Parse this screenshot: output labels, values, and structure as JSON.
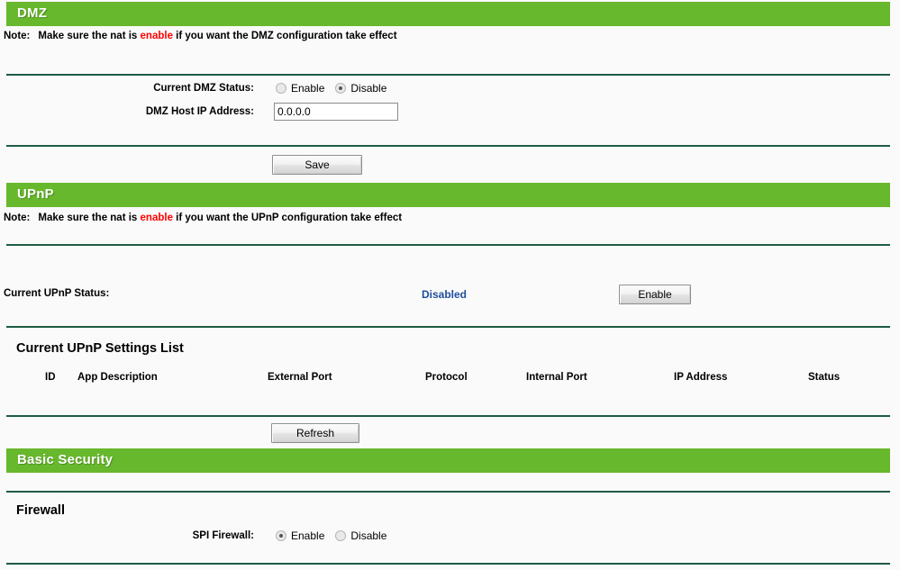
{
  "theme": {
    "bar_green": "#68b82d",
    "divider_green": "#1f5c43",
    "link_blue": "#1f4e9c",
    "note_highlight": "#ff0000",
    "page_bg": "#fafafa"
  },
  "sections": {
    "dmz": {
      "title": "DMZ",
      "note_prefix": "Note:",
      "note_part1": "Make sure the nat is",
      "note_highlight": "enable",
      "note_part2": "if you want the DMZ configuration take effect",
      "status_label": "Current DMZ Status:",
      "status_options": [
        {
          "label": "Enable",
          "checked": false
        },
        {
          "label": "Disable",
          "checked": true
        }
      ],
      "host_ip_label": "DMZ Host IP Address:",
      "host_ip_value": "0.0.0.0",
      "host_ip_placeholder": "0.0.0.0",
      "save_label": "Save"
    },
    "upnp": {
      "title": "UPnP",
      "note_prefix": "Note:",
      "note_part1": "Make sure the nat is",
      "note_highlight": "enable",
      "note_part2": "if you want the UPnP configuration take effect",
      "status_label": "Current UPnP Status:",
      "status_value": "Disabled",
      "toggle_button_label": "Enable",
      "list_heading": "Current UPnP Settings List",
      "table": {
        "columns": [
          "ID",
          "App Description",
          "External Port",
          "Protocol",
          "Internal Port",
          "IP Address",
          "Status"
        ],
        "rows": []
      },
      "refresh_label": "Refresh"
    },
    "basic_security": {
      "title": "Basic Security",
      "firewall_heading": "Firewall",
      "spi_label": "SPI Firewall:",
      "spi_options": [
        {
          "label": "Enable",
          "checked": true
        },
        {
          "label": "Disable",
          "checked": false
        }
      ]
    }
  }
}
